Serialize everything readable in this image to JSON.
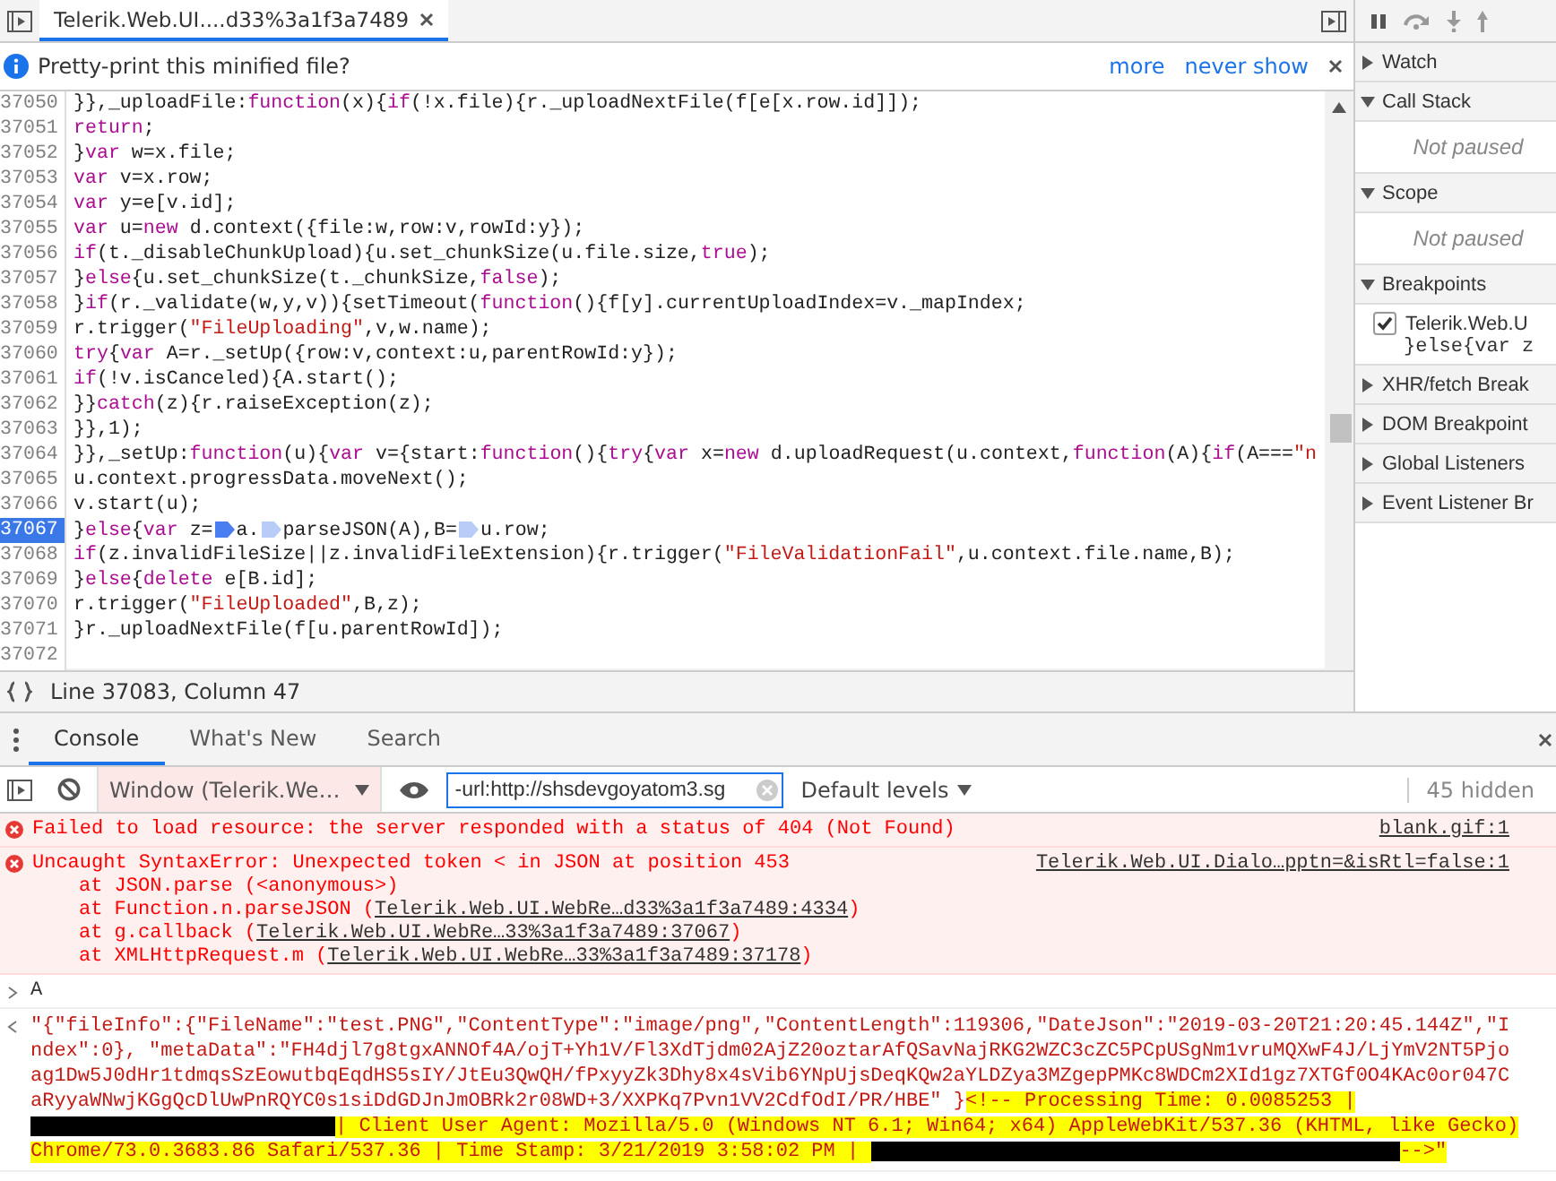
{
  "editor": {
    "tab": {
      "title": "Telerik.Web.UI....d33%3a1f3a7489",
      "selected": true
    },
    "infobar": {
      "message": "Pretty-print this minified file?",
      "links": [
        "more",
        "never show"
      ]
    },
    "lines": [
      {
        "number": "37050",
        "breakpoint": false,
        "segments": [
          {
            "kind": "plain",
            "text": "}},_uploadFile:"
          },
          {
            "kind": "keyword",
            "text": "function"
          },
          {
            "kind": "plain",
            "text": "(x){"
          },
          {
            "kind": "keyword",
            "text": "if"
          },
          {
            "kind": "plain",
            "text": "(!x.file){r._uploadNextFile(f[e[x.row.id]]);"
          }
        ]
      },
      {
        "number": "37051",
        "breakpoint": false,
        "segments": [
          {
            "kind": "keyword",
            "text": "return"
          },
          {
            "kind": "plain",
            "text": ";"
          }
        ]
      },
      {
        "number": "37052",
        "breakpoint": false,
        "segments": [
          {
            "kind": "plain",
            "text": "}"
          },
          {
            "kind": "keyword",
            "text": "var"
          },
          {
            "kind": "plain",
            "text": " w=x.file;"
          }
        ]
      },
      {
        "number": "37053",
        "breakpoint": false,
        "segments": [
          {
            "kind": "keyword",
            "text": "var"
          },
          {
            "kind": "plain",
            "text": " v=x.row;"
          }
        ]
      },
      {
        "number": "37054",
        "breakpoint": false,
        "segments": [
          {
            "kind": "keyword",
            "text": "var"
          },
          {
            "kind": "plain",
            "text": " y=e[v.id];"
          }
        ]
      },
      {
        "number": "37055",
        "breakpoint": false,
        "segments": [
          {
            "kind": "keyword",
            "text": "var"
          },
          {
            "kind": "plain",
            "text": " u="
          },
          {
            "kind": "keyword",
            "text": "new"
          },
          {
            "kind": "plain",
            "text": " d.context({file:w,row:v,rowId:y});"
          }
        ]
      },
      {
        "number": "37056",
        "breakpoint": false,
        "segments": [
          {
            "kind": "keyword",
            "text": "if"
          },
          {
            "kind": "plain",
            "text": "(t._disableChunkUpload){u.set_chunkSize(u.file.size,"
          },
          {
            "kind": "keyword",
            "text": "true"
          },
          {
            "kind": "plain",
            "text": ");"
          }
        ]
      },
      {
        "number": "37057",
        "breakpoint": false,
        "segments": [
          {
            "kind": "plain",
            "text": "}"
          },
          {
            "kind": "keyword",
            "text": "else"
          },
          {
            "kind": "plain",
            "text": "{u.set_chunkSize(t._chunkSize,"
          },
          {
            "kind": "keyword",
            "text": "false"
          },
          {
            "kind": "plain",
            "text": ");"
          }
        ]
      },
      {
        "number": "37058",
        "breakpoint": false,
        "segments": [
          {
            "kind": "plain",
            "text": "}"
          },
          {
            "kind": "keyword",
            "text": "if"
          },
          {
            "kind": "plain",
            "text": "(r._validate(w,y,v)){setTimeout("
          },
          {
            "kind": "keyword",
            "text": "function"
          },
          {
            "kind": "plain",
            "text": "(){f[y].currentUploadIndex=v._mapIndex;"
          }
        ]
      },
      {
        "number": "37059",
        "breakpoint": false,
        "segments": [
          {
            "kind": "plain",
            "text": "r.trigger("
          },
          {
            "kind": "string",
            "text": "\"FileUploading\""
          },
          {
            "kind": "plain",
            "text": ",v,w.name);"
          }
        ]
      },
      {
        "number": "37060",
        "breakpoint": false,
        "segments": [
          {
            "kind": "keyword",
            "text": "try"
          },
          {
            "kind": "plain",
            "text": "{"
          },
          {
            "kind": "keyword",
            "text": "var"
          },
          {
            "kind": "plain",
            "text": " A=r._setUp({row:v,context:u,parentRowId:y});"
          }
        ]
      },
      {
        "number": "37061",
        "breakpoint": false,
        "segments": [
          {
            "kind": "keyword",
            "text": "if"
          },
          {
            "kind": "plain",
            "text": "(!v.isCanceled){A.start();"
          }
        ]
      },
      {
        "number": "37062",
        "breakpoint": false,
        "segments": [
          {
            "kind": "plain",
            "text": "}}"
          },
          {
            "kind": "keyword",
            "text": "catch"
          },
          {
            "kind": "plain",
            "text": "(z){r.raiseException(z);"
          }
        ]
      },
      {
        "number": "37063",
        "breakpoint": false,
        "segments": [
          {
            "kind": "plain",
            "text": "}},1);"
          }
        ]
      },
      {
        "number": "37064",
        "breakpoint": false,
        "segments": [
          {
            "kind": "plain",
            "text": "}},_setUp:"
          },
          {
            "kind": "keyword",
            "text": "function"
          },
          {
            "kind": "plain",
            "text": "(u){"
          },
          {
            "kind": "keyword",
            "text": "var"
          },
          {
            "kind": "plain",
            "text": " v={start:"
          },
          {
            "kind": "keyword",
            "text": "function"
          },
          {
            "kind": "plain",
            "text": "(){"
          },
          {
            "kind": "keyword",
            "text": "try"
          },
          {
            "kind": "plain",
            "text": "{"
          },
          {
            "kind": "keyword",
            "text": "var"
          },
          {
            "kind": "plain",
            "text": " x="
          },
          {
            "kind": "keyword",
            "text": "new"
          },
          {
            "kind": "plain",
            "text": " d.uploadRequest(u.context,"
          },
          {
            "kind": "keyword",
            "text": "function"
          },
          {
            "kind": "plain",
            "text": "(A){"
          },
          {
            "kind": "keyword",
            "text": "if"
          },
          {
            "kind": "plain",
            "text": "(A==="
          },
          {
            "kind": "string",
            "text": "\"n"
          }
        ]
      },
      {
        "number": "37065",
        "breakpoint": false,
        "segments": [
          {
            "kind": "plain",
            "text": "u.context.progressData.moveNext();"
          }
        ]
      },
      {
        "number": "37066",
        "breakpoint": false,
        "segments": [
          {
            "kind": "plain",
            "text": "v.start(u);"
          }
        ]
      },
      {
        "number": "37067",
        "breakpoint": true,
        "segments": [
          {
            "kind": "plain",
            "text": "}"
          },
          {
            "kind": "keyword",
            "text": "else"
          },
          {
            "kind": "plain",
            "text": "{"
          },
          {
            "kind": "keyword",
            "text": "var"
          },
          {
            "kind": "plain",
            "text": " z="
          },
          {
            "kind": "marker",
            "active": true
          },
          {
            "kind": "plain",
            "text": "a."
          },
          {
            "kind": "marker",
            "active": false
          },
          {
            "kind": "plain",
            "text": "parseJSON(A),B="
          },
          {
            "kind": "marker",
            "active": false
          },
          {
            "kind": "plain",
            "text": "u.row;"
          }
        ]
      },
      {
        "number": "37068",
        "breakpoint": false,
        "segments": [
          {
            "kind": "keyword",
            "text": "if"
          },
          {
            "kind": "plain",
            "text": "(z.invalidFileSize||z.invalidFileExtension){r.trigger("
          },
          {
            "kind": "string",
            "text": "\"FileValidationFail\""
          },
          {
            "kind": "plain",
            "text": ",u.context.file.name,B);"
          }
        ]
      },
      {
        "number": "37069",
        "breakpoint": false,
        "segments": [
          {
            "kind": "plain",
            "text": "}"
          },
          {
            "kind": "keyword",
            "text": "else"
          },
          {
            "kind": "plain",
            "text": "{"
          },
          {
            "kind": "keyword",
            "text": "delete"
          },
          {
            "kind": "plain",
            "text": " e[B.id];"
          }
        ]
      },
      {
        "number": "37070",
        "breakpoint": false,
        "segments": [
          {
            "kind": "plain",
            "text": "r.trigger("
          },
          {
            "kind": "string",
            "text": "\"FileUploaded\""
          },
          {
            "kind": "plain",
            "text": ",B,z);"
          }
        ]
      },
      {
        "number": "37071",
        "breakpoint": false,
        "segments": [
          {
            "kind": "plain",
            "text": "}r._uploadNextFile(f[u.parentRowId]);"
          }
        ]
      },
      {
        "number": "37072",
        "breakpoint": false
      }
    ],
    "status": "Line 37083, Column 47"
  },
  "debugger": {
    "sections": [
      {
        "title": "Watch",
        "expanded": false
      },
      {
        "title": "Call Stack",
        "expanded": true,
        "empty_text": "Not paused"
      },
      {
        "title": "Scope",
        "expanded": true,
        "empty_text": "Not paused"
      },
      {
        "title": "Breakpoints",
        "expanded": true,
        "items": [
          {
            "file": "Telerik.Web.U",
            "code": "}else{var z",
            "checked": true
          }
        ]
      },
      {
        "title": "XHR/fetch Break",
        "expanded": false
      },
      {
        "title": "DOM Breakpoint",
        "expanded": false
      },
      {
        "title": "Global Listeners",
        "expanded": false
      },
      {
        "title": "Event Listener Br",
        "expanded": false
      }
    ]
  },
  "console": {
    "tabs": [
      {
        "label": "Console",
        "selected": true
      },
      {
        "label": "What's New",
        "selected": false
      },
      {
        "label": "Search",
        "selected": false
      }
    ],
    "context": "Window (Telerik.We…",
    "filter": "-url:http://shsdevgoyatom3.sg",
    "levels": "Default levels",
    "hidden": "45 hidden",
    "messages": [
      {
        "kind": "error",
        "text": "Failed to load resource: the server responded with a status of 404 (Not Found)",
        "source": "blank.gif:1"
      },
      {
        "kind": "error",
        "text": "Uncaught SyntaxError: Unexpected token < in JSON at position 453",
        "source": "Telerik.Web.UI.Dialo…pptn=&isRtl=false:1",
        "stack": [
          {
            "text": "at JSON.parse (<anonymous>)"
          },
          {
            "text": "at Function.n.parseJSON (",
            "link": "Telerik.Web.UI.WebRe…d33%3a1f3a7489:4334",
            "suffix": ")"
          },
          {
            "text": "at g.callback (",
            "link": "Telerik.Web.UI.WebRe…33%3a1f3a7489:37067",
            "suffix": ")"
          },
          {
            "text": "at XMLHttpRequest.m (",
            "link": "Telerik.Web.UI.WebRe…33%3a1f3a7489:37178",
            "suffix": ")"
          }
        ]
      },
      {
        "kind": "input",
        "text": "A"
      },
      {
        "kind": "result",
        "segments": [
          {
            "kind": "plain",
            "text": "\"{\"fileInfo\":{\"FileName\":\"test.PNG\",\"ContentType\":\"image/png\",\"ContentLength\":119306,\"DateJson\":\"2019-03-20T21:20:45.144Z\",\"Index\":0}, \"metaData\":\"FH4djl7g8tgxANNOf4A/ojT+Yh1V/Fl3XdTjdm02AjZ20oztarAfQSavNajRKG2WZC3cZC5PCpUSgNm1vruMQXwF4J/LjYmV2NT5Pjoag1Dw5J0dHr1tdmqsSzEowutbqEqdHS5sIY/JtEu3QwQH/fPxyyZk3Dhy8x4sVib6YNpUjsDeqKQw2aYLDZya3MZgepPMKc8WDCm2XId1gz7XTGf0O4KAc0or047CaRyyaWNwjKGgQcDlUwPnRQYC0s1siDdGDJnJmOBRk2r08WD+3/XXPKq7Pvn1VV2CdfOdI/PR/HBE\" }"
          },
          {
            "kind": "highlight",
            "text": "<!--  Processing Time: 0.0085253 | "
          },
          {
            "kind": "redacted"
          },
          {
            "kind": "highlight",
            "text": "| Client User Agent: Mozilla/5.0 (Windows NT 6.1; Win64; x64) AppleWebKit/537.36 (KHTML, like Gecko) Chrome/73.0.3683.86 Safari/537.36 | Time Stamp: 3/21/2019 3:58:02 PM | "
          },
          {
            "kind": "redacted"
          },
          {
            "kind": "highlight",
            "text": "-->\""
          }
        ]
      }
    ]
  }
}
